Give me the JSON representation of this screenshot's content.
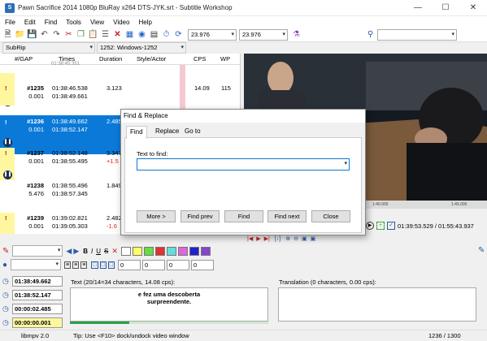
{
  "window": {
    "title": "Pawn Sacrifice 2014 1080p BluRay x264 DTS-JYK.srt - Subtitle Workshop",
    "app_icon": "subtitle-workshop-icon"
  },
  "menu": [
    "File",
    "Edit",
    "Find",
    "Tools",
    "View",
    "Video",
    "Help"
  ],
  "toolbar": {
    "fps1": "23.976",
    "fps2": "23.976",
    "search_value": ""
  },
  "format": {
    "subtitle_format": "SubRip",
    "encoding": "1252: Windows-1252"
  },
  "grid": {
    "headers": {
      "gap": "#/GAP",
      "times": "Times",
      "duration": "Duration",
      "style": "Style/Actor",
      "cps": "CPS",
      "wp": "WP"
    },
    "top_partial": {
      "times": "01:38:45.351"
    },
    "rows": [
      {
        "num": "#1235",
        "gap": "0.001",
        "start": "01:38:46.538",
        "end": "01:38:49.661",
        "dur": "3.123",
        "dur2": "",
        "cps": "14.09",
        "wp": "115",
        "flag": "!",
        "selected": false
      },
      {
        "num": "#1236",
        "gap": "0.001",
        "start": "01:38:49.662",
        "end": "01:38:52.147",
        "dur": "2.485",
        "dur2": "",
        "cps": "",
        "wp": "",
        "flag": "!",
        "selected": true
      },
      {
        "num": "#1237",
        "gap": "0.001",
        "start": "01:38:52.148",
        "end": "01:38:55.495",
        "dur": "3.347",
        "dur2": "+1.5",
        "cps": "",
        "wp": "",
        "flag": "!",
        "selected": false
      },
      {
        "num": "#1238",
        "gap": "5.476",
        "start": "01:38:55.496",
        "end": "01:38:57.345",
        "dur": "1.849",
        "dur2": "",
        "cps": "",
        "wp": "",
        "flag": "",
        "selected": false
      },
      {
        "num": "#1239",
        "gap": "0.001",
        "start": "01:39:02.821",
        "end": "01:39:05.303",
        "dur": "2.482",
        "dur2": "-1.6",
        "cps": "",
        "wp": "",
        "flag": "!",
        "selected": false
      }
    ]
  },
  "video": {
    "ticks": [
      "1:40.000",
      "1:45.000"
    ],
    "time_readout": "01:39:53.529 / 01:55:43.937"
  },
  "editor": {
    "start": "01:38:49.662",
    "end": "01:38:52.147",
    "duration": "00:00:02.485",
    "pause": "00:00:00.001",
    "text_label": "Text (20/14=34 characters, 14.08 cps):",
    "text_line1": "e fez uma descoberta",
    "text_line2": "surpreendente.",
    "translation_label": "Translation (0 characters, 0.00 cps):",
    "spin_values": [
      "0",
      "0",
      "0",
      "0"
    ],
    "swatches": [
      "#ffffff",
      "#ffff66",
      "#66dd44",
      "#dd3333",
      "#66dddd",
      "#dd66dd",
      "#2222cc",
      "#8844cc"
    ]
  },
  "status": {
    "libmpv": "libmpv 2.0",
    "tip": "Tip: Use <F10> dock/undock video window",
    "count": "1236 / 1300"
  },
  "dialog": {
    "title": "Find & Replace",
    "tabs": [
      "Find",
      "Replace",
      "Go to"
    ],
    "label": "Text to find:",
    "value": "",
    "buttons": {
      "more": "More >",
      "prev": "Find prev",
      "find": "Find",
      "next": "Find next",
      "close": "Close"
    }
  }
}
